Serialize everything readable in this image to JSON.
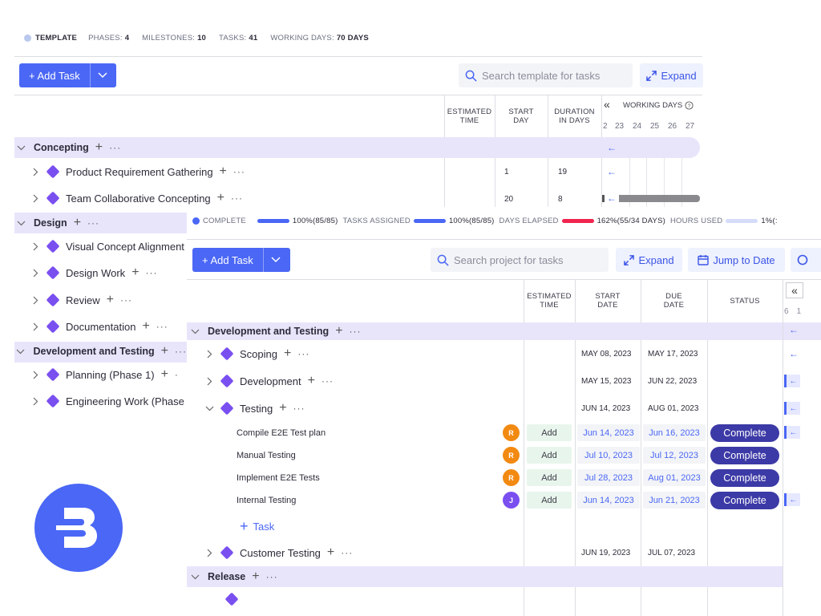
{
  "template": {
    "meta": {
      "label": "TEMPLATE",
      "phases_label": "PHASES:",
      "phases_value": "4",
      "milestones_label": "MILESTONES:",
      "milestones_value": "10",
      "tasks_label": "TASKS:",
      "tasks_value": "41",
      "working_days_label": "WORKING DAYS:",
      "working_days_value": "70 DAYS"
    },
    "toolbar": {
      "add_task_label": "+ Add Task",
      "search_placeholder": "Search template for tasks",
      "expand_label": "Expand"
    },
    "columns": {
      "estimated_time": [
        "ESTIMATED",
        "TIME"
      ],
      "start_day": [
        "START",
        "DAY"
      ],
      "duration": [
        "DURATION",
        "IN DAYS"
      ],
      "working_days": "WORKING DAYS"
    },
    "gantt_days": [
      "2",
      "23",
      "24",
      "25",
      "26",
      "27"
    ],
    "rows": {
      "concepting": "Concepting",
      "product_requirement": "Product Requirement Gathering",
      "product_requirement_start": "1",
      "product_requirement_duration": "19",
      "team_collab": "Team Collaborative Concepting",
      "team_collab_start": "20",
      "team_collab_duration": "8",
      "design": "Design",
      "visual_concept": "Visual Concept Alignment",
      "design_work": "Design Work",
      "review": "Review",
      "documentation": "Documentation",
      "dev_testing": "Development and Testing",
      "planning": "Planning (Phase 1)",
      "engineering": "Engineering Work (Phase"
    }
  },
  "project": {
    "meta": {
      "complete_label": "COMPLETE",
      "complete_value": "100%(85/85)",
      "tasks_assigned_label": "TASKS ASSIGNED",
      "tasks_assigned_value": "100%(85/85)",
      "days_elapsed_label": "DAYS ELAPSED",
      "days_elapsed_value": "162%(55/34 DAYS)",
      "hours_used_label": "HOURS USED",
      "hours_used_value": "1%(:"
    },
    "toolbar": {
      "add_task_label": "+ Add Task",
      "search_placeholder": "Search project for tasks",
      "expand_label": "Expand",
      "jump_label": "Jump to Date"
    },
    "columns": {
      "estimated_time": [
        "ESTIMATED",
        "TIME"
      ],
      "start_date": [
        "START",
        "DATE"
      ],
      "due_date": [
        "DUE",
        "DATE"
      ],
      "status": "STATUS"
    },
    "gantt_days": [
      "6",
      "1"
    ],
    "phases": {
      "dev_testing": "Development and Testing",
      "release": "Release"
    },
    "milestones": {
      "scoping": {
        "name": "Scoping",
        "start": "MAY 08, 2023",
        "due": "MAY 17, 2023"
      },
      "development": {
        "name": "Development",
        "start": "MAY 15, 2023",
        "due": "JUN 22, 2023"
      },
      "testing": {
        "name": "Testing",
        "start": "JUN 14, 2023",
        "due": "AUG 01, 2023"
      },
      "customer_testing": {
        "name": "Customer Testing",
        "start": "JUN 19, 2023",
        "due": "JUL 07, 2023"
      }
    },
    "tasks": [
      {
        "name": "Compile E2E Test plan",
        "initial": "R",
        "est": "Add",
        "start": "Jun 14, 2023",
        "due": "Jun 16, 2023",
        "status": "Complete"
      },
      {
        "name": "Manual Testing",
        "initial": "R",
        "est": "Add",
        "start": "Jul 10, 2023",
        "due": "Jul 12, 2023",
        "status": "Complete"
      },
      {
        "name": "Implement E2E Tests",
        "initial": "R",
        "est": "Add",
        "start": "Jul 28, 2023",
        "due": "Aug 01, 2023",
        "status": "Complete"
      },
      {
        "name": "Internal Testing",
        "initial": "J",
        "est": "Add",
        "start": "Jun 14, 2023",
        "due": "Jun 21, 2023",
        "status": "Complete"
      }
    ],
    "add_task_inline": "Task"
  },
  "colors": {
    "accent": "#4a67f5",
    "milestone": "#7a4ff0",
    "status": "#3c3aa6",
    "phase_band": "#e8e5fb",
    "avatar_r": "#f28a12",
    "avatar_j": "#7a4ff0",
    "days_elapsed": "#f0244f",
    "hours_used": "#d5dcf9"
  }
}
